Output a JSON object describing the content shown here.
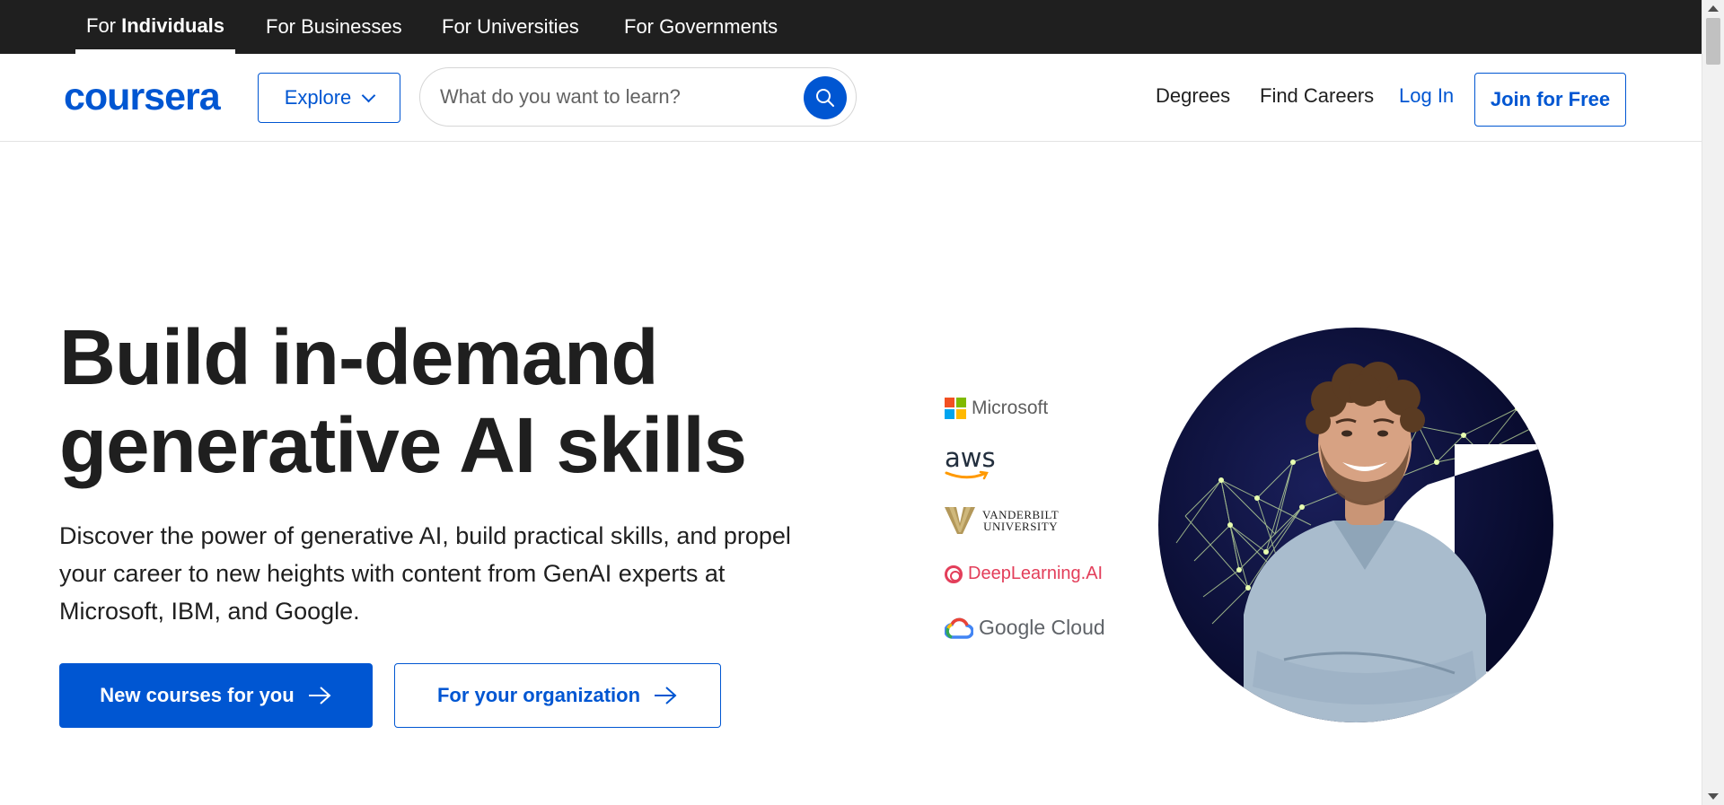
{
  "topbar": {
    "tabs": [
      {
        "prefix": "For ",
        "strong": "Individuals"
      },
      {
        "label": "For Businesses"
      },
      {
        "label": "For Universities"
      },
      {
        "label": "For Governments"
      }
    ]
  },
  "header": {
    "logo": "coursera",
    "explore_label": "Explore",
    "search_placeholder": "What do you want to learn?",
    "nav": {
      "degrees": "Degrees",
      "find_careers": "Find Careers",
      "login": "Log In",
      "join": "Join for Free"
    }
  },
  "hero": {
    "title_line1": "Build in-demand",
    "title_line2": "generative AI skills",
    "subtitle_line1": "Discover the power of generative AI, build practical skills, and propel",
    "subtitle_line2": "your career to new heights with content from GenAI experts at",
    "subtitle_line3": "Microsoft, IBM, and Google.",
    "primary_cta": "New courses for you",
    "secondary_cta": "For your organization"
  },
  "partners": {
    "microsoft": "Microsoft",
    "aws": "aws",
    "vanderbilt_line1": "VANDERBILT",
    "vanderbilt_line2": "UNIVERSITY",
    "deeplearning": "DeepLearning.AI",
    "google_cloud": "Google Cloud"
  },
  "colors": {
    "brand_blue": "#0056d2",
    "topbar_bg": "#1f1f1f",
    "text": "#1f1f1f"
  }
}
